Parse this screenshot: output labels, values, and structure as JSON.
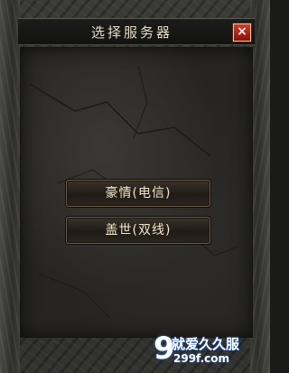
{
  "window": {
    "title": "选择服务器",
    "close_label": "×"
  },
  "servers": [
    {
      "label": "豪情(电信)"
    },
    {
      "label": "盖世(双线)"
    }
  ],
  "watermark": {
    "logo_digit": "9",
    "site_name": "就爱久久服",
    "url": "299f.com"
  },
  "colors": {
    "close_button": "#c02818",
    "title_text": "#e8dcc0",
    "button_text": "#f2e6c8"
  }
}
